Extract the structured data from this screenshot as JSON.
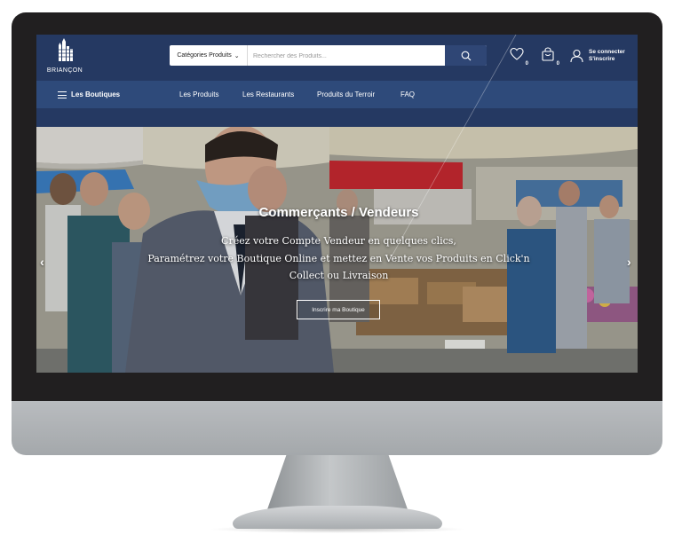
{
  "brand": {
    "name": "BRIANÇON"
  },
  "search": {
    "category_label": "Catégories Produits",
    "placeholder": "Rechercher des Produits..."
  },
  "header_icons": {
    "wishlist_count": "0",
    "cart_count": "0",
    "login_label": "Se connecter",
    "signup_label": "S'inscrire"
  },
  "nav": {
    "shops_label": "Les Boutiques",
    "items": [
      "Les Produits",
      "Les Restaurants",
      "Produits du Terroir",
      "FAQ"
    ]
  },
  "hero": {
    "title": "Commerçants / Vendeurs",
    "lines": [
      "Créez votre Compte Vendeur en quelques clics,",
      "Paramétrez votre Boutique Online et mettez en Vente vos Produits en Click'n",
      "Collect ou Livraison"
    ],
    "cta_label": "Inscrire ma Boutique"
  },
  "colors": {
    "header_bg": "#253962",
    "nav_bg": "#2e4a7a",
    "monitor_frame": "#211f20",
    "monitor_chin": "#b0b3b6"
  },
  "icons": {
    "menu": "hamburger-icon",
    "search": "search-icon",
    "wishlist": "heart-icon",
    "cart": "shopping-bag-icon",
    "user": "user-icon",
    "prev": "chevron-left-icon",
    "next": "chevron-right-icon"
  }
}
